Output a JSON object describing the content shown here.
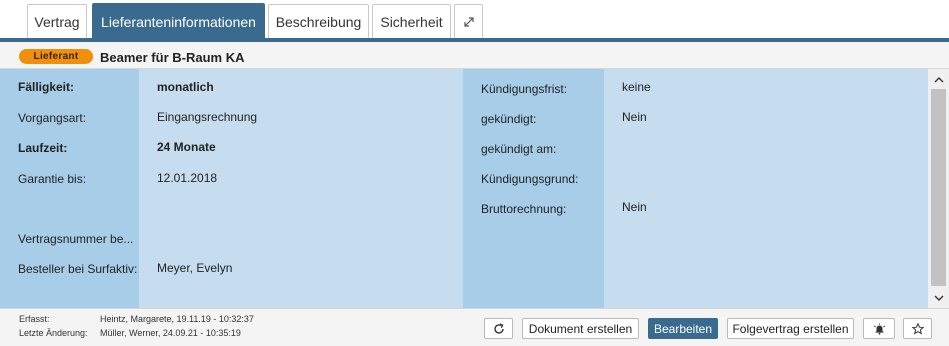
{
  "tabs": [
    {
      "label": "Vertrag"
    },
    {
      "label": "Lieferanteninformationen"
    },
    {
      "label": "Beschreibung"
    },
    {
      "label": "Sicherheit"
    }
  ],
  "expand_icon": "expand-icon",
  "header": {
    "badge": "Lieferant",
    "title": "Beamer für B-Raum KA"
  },
  "left_fields": [
    {
      "label": "Fälligkeit:",
      "value": "monatlich"
    },
    {
      "label": "Vorgangsart:",
      "value": "Eingangsrechnung"
    },
    {
      "label": "Laufzeit:",
      "value": "24 Monate"
    },
    {
      "label": "Garantie bis:",
      "value": "12.01.2018"
    },
    {
      "label": "Vertragsnummer be...",
      "value": ""
    },
    {
      "label": "Besteller bei Surfaktiv:",
      "value": "Meyer, Evelyn"
    }
  ],
  "right_fields": [
    {
      "label": "Kündigungsfrist:",
      "value": "keine"
    },
    {
      "label": "gekündigt:",
      "value": "Nein"
    },
    {
      "label": "gekündigt am:",
      "value": ""
    },
    {
      "label": "Kündigungsgrund:",
      "value": ""
    },
    {
      "label": "Bruttorechnung:",
      "value": "Nein"
    }
  ],
  "footer": {
    "created_label": "Erfasst:",
    "created_value": "Heintz, Margarete, 19.11.19 - 10:32:37",
    "changed_label": "Letzte Änderung:",
    "changed_value": "Müller, Werner, 24.09.21 - 10:35:19",
    "buttons": {
      "refresh_icon": "refresh-icon",
      "create_document": "Dokument erstellen",
      "edit": "Bearbeiten",
      "follow_up": "Folgevertrag erstellen",
      "bell_icon": "bell-icon",
      "star_icon": "star-icon"
    }
  },
  "colors": {
    "accent": "#3a6b8e",
    "badge": "#f0900a",
    "panel": "#c5ddef",
    "label_column": "#a7cde8"
  }
}
